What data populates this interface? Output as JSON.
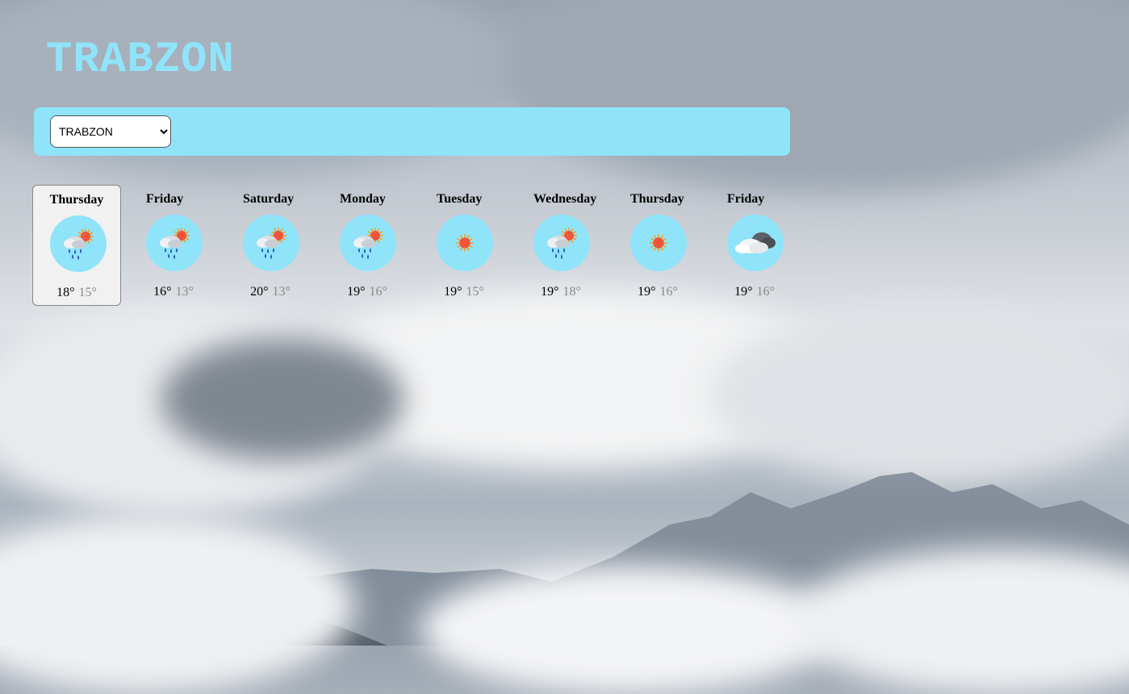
{
  "city": {
    "title": "TRABZON"
  },
  "selector": {
    "selected": "TRABZON",
    "options": [
      "TRABZON"
    ]
  },
  "colors": {
    "accent": "#8fe4fa",
    "active_card": "#f1f1f1"
  },
  "forecast": [
    {
      "day": "Thursday",
      "icon": "rain-sun-icon",
      "max": "18°",
      "min": "15°",
      "active": true
    },
    {
      "day": "Friday",
      "icon": "rain-sun-icon",
      "max": "16°",
      "min": "13°"
    },
    {
      "day": "Saturday",
      "icon": "rain-sun-icon",
      "max": "20°",
      "min": "13°"
    },
    {
      "day": "Monday",
      "icon": "rain-sun-icon",
      "max": "19°",
      "min": "16°"
    },
    {
      "day": "Tuesday",
      "icon": "sun-icon",
      "max": "19°",
      "min": "15°"
    },
    {
      "day": "Wednesday",
      "icon": "rain-sun-icon",
      "max": "19°",
      "min": "18°"
    },
    {
      "day": "Thursday",
      "icon": "sun-icon",
      "max": "19°",
      "min": "16°"
    },
    {
      "day": "Friday",
      "icon": "cloud-icon",
      "max": "19°",
      "min": "16°"
    }
  ]
}
